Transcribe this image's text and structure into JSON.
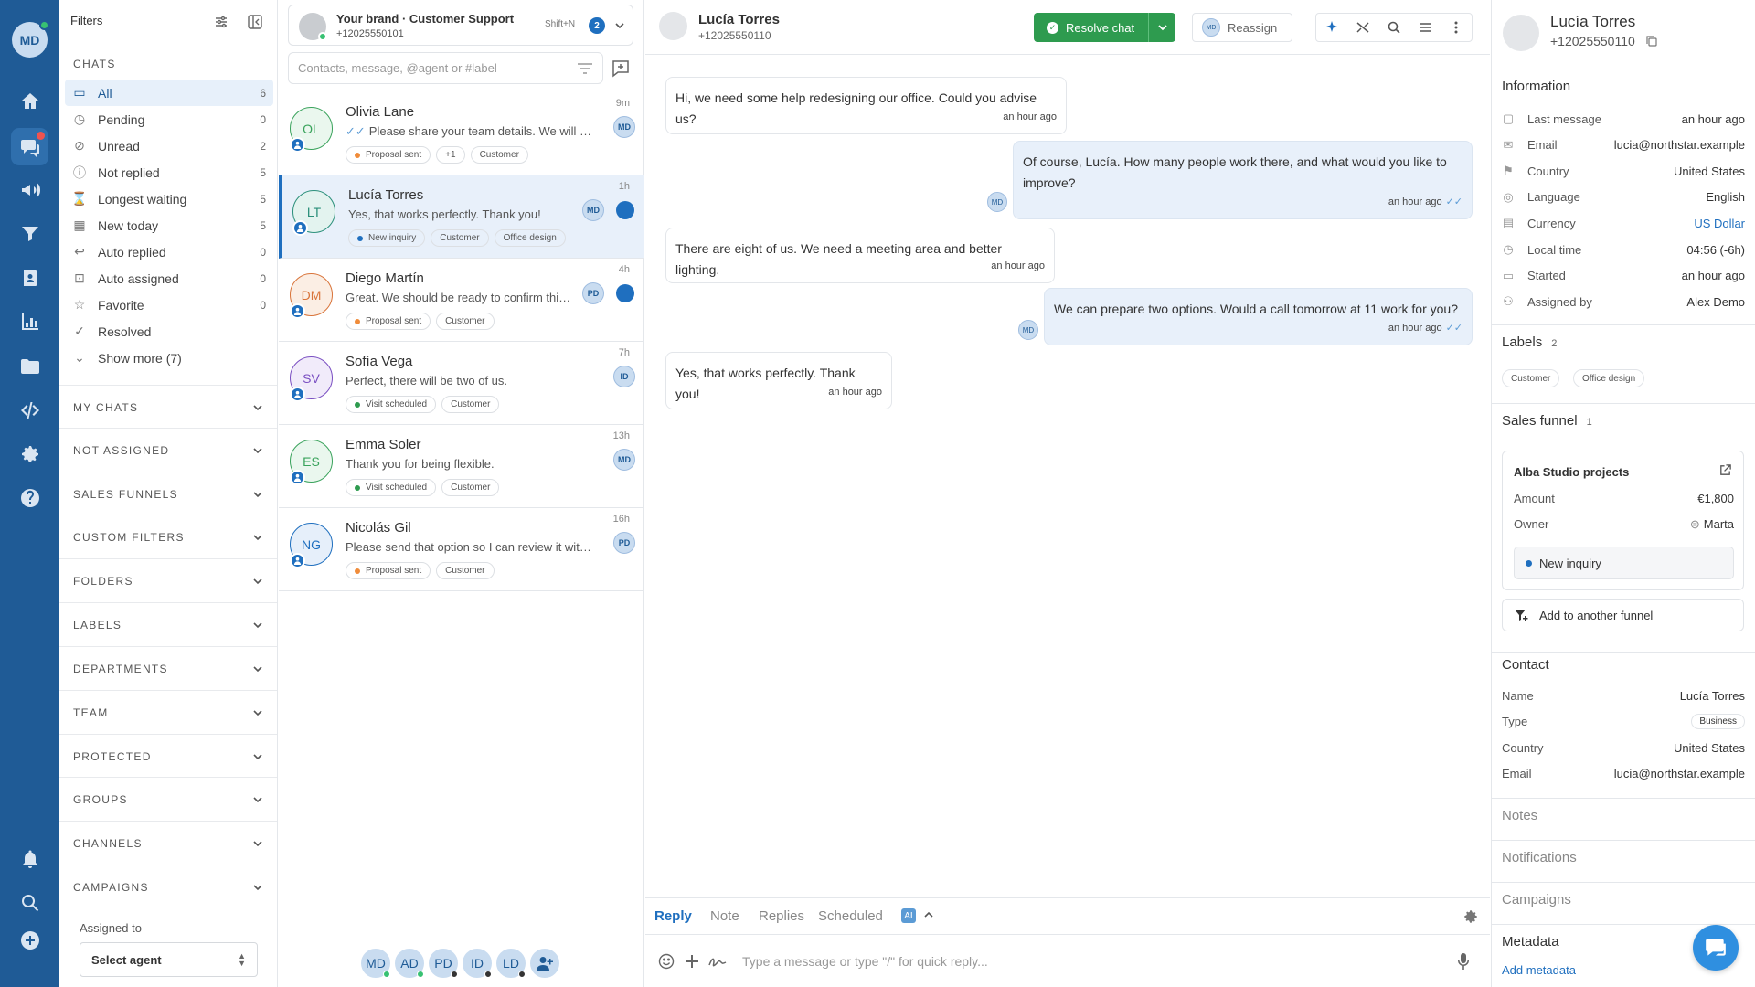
{
  "user": {
    "initials": "MD"
  },
  "filters": {
    "title": "Filters",
    "chats_heading": "CHATS",
    "chat_filters": [
      {
        "label": "All",
        "count": "6",
        "icon": "inbox-icon"
      },
      {
        "label": "Pending",
        "count": "0",
        "icon": "clock-icon"
      },
      {
        "label": "Unread",
        "count": "2",
        "icon": "eye-off-icon"
      },
      {
        "label": "Not replied",
        "count": "5",
        "icon": "alert-circle-icon"
      },
      {
        "label": "Longest waiting",
        "count": "5",
        "icon": "hourglass-icon"
      },
      {
        "label": "New today",
        "count": "5",
        "icon": "calendar-icon"
      },
      {
        "label": "Auto replied",
        "count": "0",
        "icon": "reply-icon"
      },
      {
        "label": "Auto assigned",
        "count": "0",
        "icon": "lock-icon"
      },
      {
        "label": "Favorite",
        "count": "0",
        "icon": "star-icon"
      },
      {
        "label": "Resolved",
        "count": "",
        "icon": "check-circle-icon"
      }
    ],
    "show_more": "Show more (7)",
    "groups": [
      "MY CHATS",
      "NOT ASSIGNED",
      "SALES FUNNELS",
      "CUSTOM FILTERS",
      "FOLDERS",
      "LABELS",
      "DEPARTMENTS",
      "TEAM",
      "PROTECTED",
      "GROUPS",
      "CHANNELS",
      "CAMPAIGNS"
    ],
    "assigned_to_label": "Assigned to",
    "select_agent": "Select agent"
  },
  "brand": {
    "name": "Your brand · Customer Support",
    "phone": "+12025550101",
    "shortcut": "Shift+N",
    "count": "2"
  },
  "search": {
    "placeholder": "Contacts, message, @agent or #label"
  },
  "chats": [
    {
      "initials": "OL",
      "name": "Olivia Lane",
      "time": "9m",
      "message": "Please share your team details. We will prepare a proposal.",
      "read_tick": "✓✓",
      "tags": [
        {
          "label": "Proposal sent",
          "color": "#f08c3a"
        },
        {
          "label": "+1",
          "color": ""
        },
        {
          "label": "Customer",
          "color": ""
        }
      ],
      "agent": "MD",
      "unread": false,
      "color": "#3aa35c",
      "bg": "#eaf7ee"
    },
    {
      "initials": "LT",
      "name": "Lucía Torres",
      "time": "1h",
      "message": "Yes, that works perfectly. Thank you!",
      "read_tick": "",
      "tags": [
        {
          "label": "New inquiry",
          "color": "#1f6fbf"
        },
        {
          "label": "Customer",
          "color": ""
        },
        {
          "label": "Office design",
          "color": ""
        }
      ],
      "agent": "MD",
      "unread": true,
      "color": "#2a8f7a",
      "bg": "#e3f3ef"
    },
    {
      "initials": "DM",
      "name": "Diego Martín",
      "time": "4h",
      "message": "Great. We should be ready to confirm this week.",
      "read_tick": "",
      "tags": [
        {
          "label": "Proposal sent",
          "color": "#f08c3a"
        },
        {
          "label": "Customer",
          "color": ""
        }
      ],
      "agent": "PD",
      "unread": true,
      "color": "#d9743a",
      "bg": "#fbeee4"
    },
    {
      "initials": "SV",
      "name": "Sofía Vega",
      "time": "7h",
      "message": "Perfect, there will be two of us.",
      "read_tick": "",
      "tags": [
        {
          "label": "Visit scheduled",
          "color": "#2e9b4f"
        },
        {
          "label": "Customer",
          "color": ""
        }
      ],
      "agent": "ID",
      "unread": false,
      "color": "#7a4fc2",
      "bg": "#f1ebfa"
    },
    {
      "initials": "ES",
      "name": "Emma Soler",
      "time": "13h",
      "message": "Thank you for being flexible.",
      "read_tick": "",
      "tags": [
        {
          "label": "Visit scheduled",
          "color": "#2e9b4f"
        },
        {
          "label": "Customer",
          "color": ""
        }
      ],
      "agent": "MD",
      "unread": false,
      "color": "#3aa35c",
      "bg": "#eaf7ee"
    },
    {
      "initials": "NG",
      "name": "Nicolás Gil",
      "time": "16h",
      "message": "Please send that option so I can review it with the team.",
      "read_tick": "",
      "tags": [
        {
          "label": "Proposal sent",
          "color": "#f08c3a"
        },
        {
          "label": "Customer",
          "color": ""
        }
      ],
      "agent": "PD",
      "unread": false,
      "color": "#1f6fbf",
      "bg": "#e6effa"
    }
  ],
  "agents_bar": [
    {
      "initials": "MD",
      "status": "#38c172"
    },
    {
      "initials": "AD",
      "status": "#38c172"
    },
    {
      "initials": "PD",
      "status": "#333333"
    },
    {
      "initials": "ID",
      "status": "#333333"
    },
    {
      "initials": "LD",
      "status": "#333333"
    }
  ],
  "conversation": {
    "name": "Lucía Torres",
    "phone": "+12025550110",
    "resolve_label": "Resolve chat",
    "reassign_label": "Reassign",
    "reassign_agent": "MD",
    "messages": [
      {
        "dir": "in",
        "text": "Hi, we need some help redesigning our office. Could you advise us?",
        "time": "an hour ago"
      },
      {
        "dir": "out",
        "text": "Of course, Lucía. How many people work there, and what would you like to improve?",
        "time": "an hour ago",
        "agent": "MD"
      },
      {
        "dir": "in",
        "text": "There are eight of us. We need a meeting area and better lighting.",
        "time": "an hour ago"
      },
      {
        "dir": "out",
        "text": "We can prepare two options. Would a call tomorrow at 11 work for you?",
        "time": "an hour ago",
        "agent": "MD"
      },
      {
        "dir": "in",
        "text": "Yes, that works perfectly. Thank you!",
        "time": "an hour ago"
      }
    ],
    "tabs": [
      "Reply",
      "Note",
      "Replies",
      "Scheduled"
    ],
    "ai_label": "AI",
    "composer_placeholder": "Type a message or type \"/\" for quick reply..."
  },
  "contact_panel": {
    "name": "Lucía Torres",
    "phone": "+12025550110",
    "information_title": "Information",
    "information": [
      {
        "key": "Last message",
        "value": "an hour ago",
        "icon": "message-icon"
      },
      {
        "key": "Email",
        "value": "lucia@northstar.example",
        "icon": "mail-icon"
      },
      {
        "key": "Country",
        "value": "United States",
        "icon": "flag-us-icon"
      },
      {
        "key": "Language",
        "value": "English",
        "icon": "globe-icon"
      },
      {
        "key": "Currency",
        "value": "US Dollar",
        "icon": "currency-icon"
      },
      {
        "key": "Local time",
        "value": "04:56 (-6h)",
        "icon": "clock-icon"
      },
      {
        "key": "Started",
        "value": "an hour ago",
        "icon": "chat-icon"
      },
      {
        "key": "Assigned by",
        "value": "Alex Demo",
        "icon": "user-icon"
      }
    ],
    "labels_title": "Labels",
    "labels_count": "2",
    "labels": [
      "Customer",
      "Office design"
    ],
    "funnel_title": "Sales funnel",
    "funnel_count": "1",
    "funnel": {
      "name": "Alba Studio projects",
      "amount_label": "Amount",
      "amount": "€1,800",
      "owner_label": "Owner",
      "owner": "Marta",
      "stage": "New inquiry"
    },
    "add_funnel": "Add to another funnel",
    "contact_title": "Contact",
    "contact": [
      {
        "key": "Name",
        "value": "Lucía Torres"
      },
      {
        "key": "Type",
        "value": "Business"
      },
      {
        "key": "Country",
        "value": "United States"
      },
      {
        "key": "Email",
        "value": "lucia@northstar.example"
      }
    ],
    "notes_title": "Notes",
    "notifications_title": "Notifications",
    "campaigns_title": "Campaigns",
    "metadata_title": "Metadata",
    "add_metadata": "Add metadata"
  }
}
